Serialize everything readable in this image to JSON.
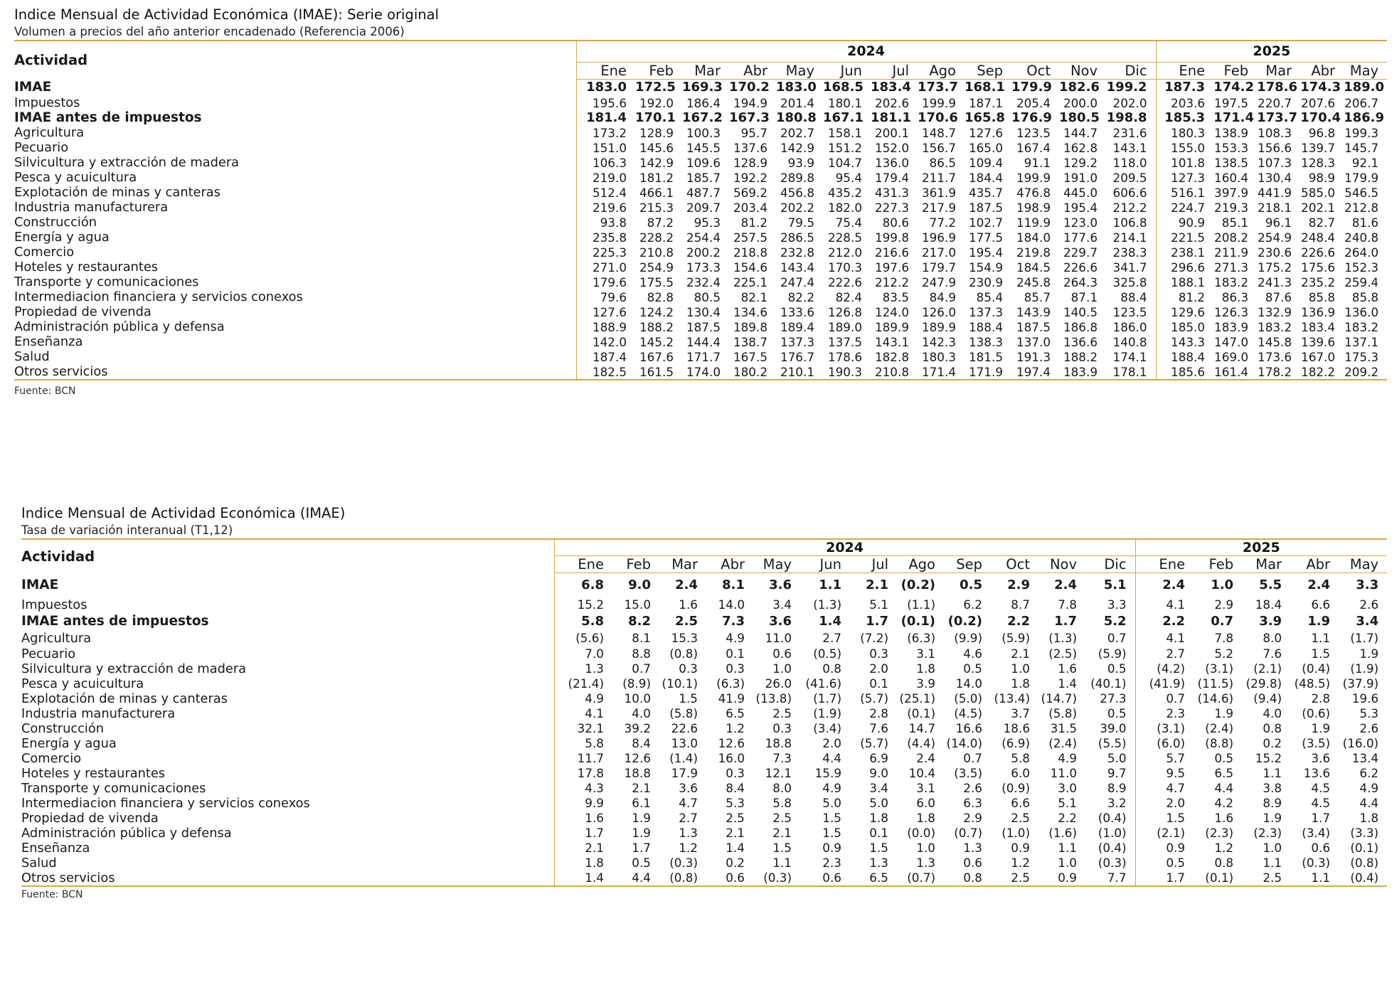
{
  "months": [
    "Ene",
    "Feb",
    "Mar",
    "Abr",
    "May",
    "Jun",
    "Jul",
    "Ago",
    "Sep",
    "Oct",
    "Nov",
    "Dic",
    "Ene",
    "Feb",
    "Mar",
    "Abr",
    "May"
  ],
  "years": [
    "2024",
    "2025"
  ],
  "column_header": "Actividad",
  "table1": {
    "title": "Indice Mensual de Actividad Económica (IMAE): Serie original",
    "subtitle": "Volumen a precios del año anterior encadenado (Referencia 2006)",
    "source": "Fuente: BCN",
    "rows": [
      {
        "name": "IMAE",
        "bold": true,
        "values": [
          "183.0",
          "172.5",
          "169.3",
          "170.2",
          "183.0",
          "168.5",
          "183.4",
          "173.7",
          "168.1",
          "179.9",
          "182.6",
          "199.2",
          "187.3",
          "174.2",
          "178.6",
          "174.3",
          "189.0"
        ]
      },
      {
        "name": "Impuestos",
        "bold": false,
        "values": [
          "195.6",
          "192.0",
          "186.4",
          "194.9",
          "201.4",
          "180.1",
          "202.6",
          "199.9",
          "187.1",
          "205.4",
          "200.0",
          "202.0",
          "203.6",
          "197.5",
          "220.7",
          "207.6",
          "206.7"
        ]
      },
      {
        "name": "IMAE antes de impuestos",
        "bold": true,
        "values": [
          "181.4",
          "170.1",
          "167.2",
          "167.3",
          "180.8",
          "167.1",
          "181.1",
          "170.6",
          "165.8",
          "176.9",
          "180.5",
          "198.8",
          "185.3",
          "171.4",
          "173.7",
          "170.4",
          "186.9"
        ]
      },
      {
        "name": "Agricultura",
        "bold": false,
        "values": [
          "173.2",
          "128.9",
          "100.3",
          "95.7",
          "202.7",
          "158.1",
          "200.1",
          "148.7",
          "127.6",
          "123.5",
          "144.7",
          "231.6",
          "180.3",
          "138.9",
          "108.3",
          "96.8",
          "199.3"
        ]
      },
      {
        "name": "Pecuario",
        "bold": false,
        "values": [
          "151.0",
          "145.6",
          "145.5",
          "137.6",
          "142.9",
          "151.2",
          "152.0",
          "156.7",
          "165.0",
          "167.4",
          "162.8",
          "143.1",
          "155.0",
          "153.3",
          "156.6",
          "139.7",
          "145.7"
        ]
      },
      {
        "name": "Silvicultura y extracción de madera",
        "bold": false,
        "values": [
          "106.3",
          "142.9",
          "109.6",
          "128.9",
          "93.9",
          "104.7",
          "136.0",
          "86.5",
          "109.4",
          "91.1",
          "129.2",
          "118.0",
          "101.8",
          "138.5",
          "107.3",
          "128.3",
          "92.1"
        ]
      },
      {
        "name": "Pesca y acuicultura",
        "bold": false,
        "values": [
          "219.0",
          "181.2",
          "185.7",
          "192.2",
          "289.8",
          "95.4",
          "179.4",
          "211.7",
          "184.4",
          "199.9",
          "191.0",
          "209.5",
          "127.3",
          "160.4",
          "130.4",
          "98.9",
          "179.9"
        ]
      },
      {
        "name": "Explotación de minas y canteras",
        "bold": false,
        "values": [
          "512.4",
          "466.1",
          "487.7",
          "569.2",
          "456.8",
          "435.2",
          "431.3",
          "361.9",
          "435.7",
          "476.8",
          "445.0",
          "606.6",
          "516.1",
          "397.9",
          "441.9",
          "585.0",
          "546.5"
        ]
      },
      {
        "name": "Industria manufacturera",
        "bold": false,
        "values": [
          "219.6",
          "215.3",
          "209.7",
          "203.4",
          "202.2",
          "182.0",
          "227.3",
          "217.9",
          "187.5",
          "198.9",
          "195.4",
          "212.2",
          "224.7",
          "219.3",
          "218.1",
          "202.1",
          "212.8"
        ]
      },
      {
        "name": "Construcción",
        "bold": false,
        "values": [
          "93.8",
          "87.2",
          "95.3",
          "81.2",
          "79.5",
          "75.4",
          "80.6",
          "77.2",
          "102.7",
          "119.9",
          "123.0",
          "106.8",
          "90.9",
          "85.1",
          "96.1",
          "82.7",
          "81.6"
        ]
      },
      {
        "name": "Energía y agua",
        "bold": false,
        "values": [
          "235.8",
          "228.2",
          "254.4",
          "257.5",
          "286.5",
          "228.5",
          "199.8",
          "196.9",
          "177.5",
          "184.0",
          "177.6",
          "214.1",
          "221.5",
          "208.2",
          "254.9",
          "248.4",
          "240.8"
        ]
      },
      {
        "name": "Comercio",
        "bold": false,
        "values": [
          "225.3",
          "210.8",
          "200.2",
          "218.8",
          "232.8",
          "212.0",
          "216.6",
          "217.0",
          "195.4",
          "219.8",
          "229.7",
          "238.3",
          "238.1",
          "211.9",
          "230.6",
          "226.6",
          "264.0"
        ]
      },
      {
        "name": "Hoteles y restaurantes",
        "bold": false,
        "values": [
          "271.0",
          "254.9",
          "173.3",
          "154.6",
          "143.4",
          "170.3",
          "197.6",
          "179.7",
          "154.9",
          "184.5",
          "226.6",
          "341.7",
          "296.6",
          "271.3",
          "175.2",
          "175.6",
          "152.3"
        ]
      },
      {
        "name": "Transporte y comunicaciones",
        "bold": false,
        "values": [
          "179.6",
          "175.5",
          "232.4",
          "225.1",
          "247.4",
          "222.6",
          "212.2",
          "247.9",
          "230.9",
          "245.8",
          "264.3",
          "325.8",
          "188.1",
          "183.2",
          "241.3",
          "235.2",
          "259.4"
        ]
      },
      {
        "name": "Intermediacion financiera y servicios conexos",
        "bold": false,
        "values": [
          "79.6",
          "82.8",
          "80.5",
          "82.1",
          "82.2",
          "82.4",
          "83.5",
          "84.9",
          "85.4",
          "85.7",
          "87.1",
          "88.4",
          "81.2",
          "86.3",
          "87.6",
          "85.8",
          "85.8"
        ]
      },
      {
        "name": "Propiedad de vivenda",
        "bold": false,
        "values": [
          "127.6",
          "124.2",
          "130.4",
          "134.6",
          "133.6",
          "126.8",
          "124.0",
          "126.0",
          "137.3",
          "143.9",
          "140.5",
          "123.5",
          "129.6",
          "126.3",
          "132.9",
          "136.9",
          "136.0"
        ]
      },
      {
        "name": "Administración pública y defensa",
        "bold": false,
        "values": [
          "188.9",
          "188.2",
          "187.5",
          "189.8",
          "189.4",
          "189.0",
          "189.9",
          "189.9",
          "188.4",
          "187.5",
          "186.8",
          "186.0",
          "185.0",
          "183.9",
          "183.2",
          "183.4",
          "183.2"
        ]
      },
      {
        "name": "Enseñanza",
        "bold": false,
        "values": [
          "142.0",
          "145.2",
          "144.4",
          "138.7",
          "137.3",
          "137.5",
          "143.1",
          "142.3",
          "138.3",
          "137.0",
          "136.6",
          "140.8",
          "143.3",
          "147.0",
          "145.8",
          "139.6",
          "137.1"
        ]
      },
      {
        "name": "Salud",
        "bold": false,
        "values": [
          "187.4",
          "167.6",
          "171.7",
          "167.5",
          "176.7",
          "178.6",
          "182.8",
          "180.3",
          "181.5",
          "191.3",
          "188.2",
          "174.1",
          "188.4",
          "169.0",
          "173.6",
          "167.0",
          "175.3"
        ]
      },
      {
        "name": "Otros servicios",
        "bold": false,
        "values": [
          "182.5",
          "161.5",
          "174.0",
          "180.2",
          "210.1",
          "190.3",
          "210.8",
          "171.4",
          "171.9",
          "197.4",
          "183.9",
          "178.1",
          "185.6",
          "161.4",
          "178.2",
          "182.2",
          "209.2"
        ]
      }
    ]
  },
  "table2": {
    "title": "Indice Mensual de Actividad Económica (IMAE)",
    "subtitle": "Tasa de variación interanual (T1,12)",
    "source": "Fuente: BCN",
    "rows": [
      {
        "name": "IMAE",
        "bold": true,
        "values": [
          "6.8",
          "9.0",
          "2.4",
          "8.1",
          "3.6",
          "1.1",
          "2.1",
          "(0.2)",
          "0.5",
          "2.9",
          "2.4",
          "5.1",
          "2.4",
          "1.0",
          "5.5",
          "2.4",
          "3.3"
        ]
      },
      {
        "name": "Impuestos",
        "bold": false,
        "values": [
          "15.2",
          "15.0",
          "1.6",
          "14.0",
          "3.4",
          "(1.3)",
          "5.1",
          "(1.1)",
          "6.2",
          "8.7",
          "7.8",
          "3.3",
          "4.1",
          "2.9",
          "18.4",
          "6.6",
          "2.6"
        ]
      },
      {
        "name": "IMAE antes de impuestos",
        "bold": true,
        "values": [
          "5.8",
          "8.2",
          "2.5",
          "7.3",
          "3.6",
          "1.4",
          "1.7",
          "(0.1)",
          "(0.2)",
          "2.2",
          "1.7",
          "5.2",
          "2.2",
          "0.7",
          "3.9",
          "1.9",
          "3.4"
        ]
      },
      {
        "name": "Agricultura",
        "bold": false,
        "values": [
          "(5.6)",
          "8.1",
          "15.3",
          "4.9",
          "11.0",
          "2.7",
          "(7.2)",
          "(6.3)",
          "(9.9)",
          "(5.9)",
          "(1.3)",
          "0.7",
          "4.1",
          "7.8",
          "8.0",
          "1.1",
          "(1.7)"
        ]
      },
      {
        "name": "Pecuario",
        "bold": false,
        "values": [
          "7.0",
          "8.8",
          "(0.8)",
          "0.1",
          "0.6",
          "(0.5)",
          "0.3",
          "3.1",
          "4.6",
          "2.1",
          "(2.5)",
          "(5.9)",
          "2.7",
          "5.2",
          "7.6",
          "1.5",
          "1.9"
        ]
      },
      {
        "name": "Silvicultura y extracción de madera",
        "bold": false,
        "values": [
          "1.3",
          "0.7",
          "0.3",
          "0.3",
          "1.0",
          "0.8",
          "2.0",
          "1.8",
          "0.5",
          "1.0",
          "1.6",
          "0.5",
          "(4.2)",
          "(3.1)",
          "(2.1)",
          "(0.4)",
          "(1.9)"
        ]
      },
      {
        "name": "Pesca y acuicultura",
        "bold": false,
        "values": [
          "(21.4)",
          "(8.9)",
          "(10.1)",
          "(6.3)",
          "26.0",
          "(41.6)",
          "0.1",
          "3.9",
          "14.0",
          "1.8",
          "1.4",
          "(40.1)",
          "(41.9)",
          "(11.5)",
          "(29.8)",
          "(48.5)",
          "(37.9)"
        ]
      },
      {
        "name": "Explotación de minas y canteras",
        "bold": false,
        "values": [
          "4.9",
          "10.0",
          "1.5",
          "41.9",
          "(13.8)",
          "(1.7)",
          "(5.7)",
          "(25.1)",
          "(5.0)",
          "(13.4)",
          "(14.7)",
          "27.3",
          "0.7",
          "(14.6)",
          "(9.4)",
          "2.8",
          "19.6"
        ]
      },
      {
        "name": "Industria manufacturera",
        "bold": false,
        "values": [
          "4.1",
          "4.0",
          "(5.8)",
          "6.5",
          "2.5",
          "(1.9)",
          "2.8",
          "(0.1)",
          "(4.5)",
          "3.7",
          "(5.8)",
          "0.5",
          "2.3",
          "1.9",
          "4.0",
          "(0.6)",
          "5.3"
        ]
      },
      {
        "name": "Construcción",
        "bold": false,
        "values": [
          "32.1",
          "39.2",
          "22.6",
          "1.2",
          "0.3",
          "(3.4)",
          "7.6",
          "14.7",
          "16.6",
          "18.6",
          "31.5",
          "39.0",
          "(3.1)",
          "(2.4)",
          "0.8",
          "1.9",
          "2.6"
        ]
      },
      {
        "name": "Energía y agua",
        "bold": false,
        "values": [
          "5.8",
          "8.4",
          "13.0",
          "12.6",
          "18.8",
          "2.0",
          "(5.7)",
          "(4.4)",
          "(14.0)",
          "(6.9)",
          "(2.4)",
          "(5.5)",
          "(6.0)",
          "(8.8)",
          "0.2",
          "(3.5)",
          "(16.0)"
        ]
      },
      {
        "name": "Comercio",
        "bold": false,
        "values": [
          "11.7",
          "12.6",
          "(1.4)",
          "16.0",
          "7.3",
          "4.4",
          "6.9",
          "2.4",
          "0.7",
          "5.8",
          "4.9",
          "5.0",
          "5.7",
          "0.5",
          "15.2",
          "3.6",
          "13.4"
        ]
      },
      {
        "name": "Hoteles y restaurantes",
        "bold": false,
        "values": [
          "17.8",
          "18.8",
          "17.9",
          "0.3",
          "12.1",
          "15.9",
          "9.0",
          "10.4",
          "(3.5)",
          "6.0",
          "11.0",
          "9.7",
          "9.5",
          "6.5",
          "1.1",
          "13.6",
          "6.2"
        ]
      },
      {
        "name": "Transporte y comunicaciones",
        "bold": false,
        "values": [
          "4.3",
          "2.1",
          "3.6",
          "8.4",
          "8.0",
          "4.9",
          "3.4",
          "3.1",
          "2.6",
          "(0.9)",
          "3.0",
          "8.9",
          "4.7",
          "4.4",
          "3.8",
          "4.5",
          "4.9"
        ]
      },
      {
        "name": "Intermediacion financiera y servicios conexos",
        "bold": false,
        "values": [
          "9.9",
          "6.1",
          "4.7",
          "5.3",
          "5.8",
          "5.0",
          "5.0",
          "6.0",
          "6.3",
          "6.6",
          "5.1",
          "3.2",
          "2.0",
          "4.2",
          "8.9",
          "4.5",
          "4.4"
        ]
      },
      {
        "name": "Propiedad de vivenda",
        "bold": false,
        "values": [
          "1.6",
          "1.9",
          "2.7",
          "2.5",
          "2.5",
          "1.5",
          "1.8",
          "1.8",
          "2.9",
          "2.5",
          "2.2",
          "(0.4)",
          "1.5",
          "1.6",
          "1.9",
          "1.7",
          "1.8"
        ]
      },
      {
        "name": "Administración pública y defensa",
        "bold": false,
        "values": [
          "1.7",
          "1.9",
          "1.3",
          "2.1",
          "2.1",
          "1.5",
          "0.1",
          "(0.0)",
          "(0.7)",
          "(1.0)",
          "(1.6)",
          "(1.0)",
          "(2.1)",
          "(2.3)",
          "(2.3)",
          "(3.4)",
          "(3.3)"
        ]
      },
      {
        "name": "Enseñanza",
        "bold": false,
        "values": [
          "2.1",
          "1.7",
          "1.2",
          "1.4",
          "1.5",
          "0.9",
          "1.5",
          "1.0",
          "1.3",
          "0.9",
          "1.1",
          "(0.4)",
          "0.9",
          "1.2",
          "1.0",
          "0.6",
          "(0.1)"
        ]
      },
      {
        "name": "Salud",
        "bold": false,
        "values": [
          "1.8",
          "0.5",
          "(0.3)",
          "0.2",
          "1.1",
          "2.3",
          "1.3",
          "1.3",
          "0.6",
          "1.2",
          "1.0",
          "(0.3)",
          "0.5",
          "0.8",
          "1.1",
          "(0.3)",
          "(0.8)"
        ]
      },
      {
        "name": "Otros servicios",
        "bold": false,
        "values": [
          "1.4",
          "4.4",
          "(0.8)",
          "0.6",
          "(0.3)",
          "0.6",
          "6.5",
          "(0.7)",
          "0.8",
          "2.5",
          "0.9",
          "7.7",
          "1.7",
          "(0.1)",
          "2.5",
          "1.1",
          "(0.4)"
        ]
      }
    ]
  }
}
